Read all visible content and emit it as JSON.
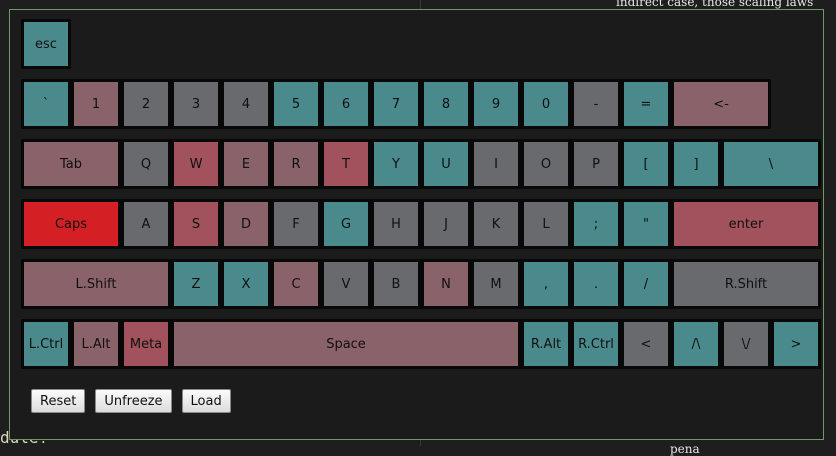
{
  "palette": {
    "teal": "#4a8a8d",
    "mauve": "#8a6269",
    "gray": "#686a6d",
    "rose": "#a2525c",
    "red": "#d41f24"
  },
  "rows": [
    [
      {
        "label": "esc",
        "color": "teal",
        "w": 1
      }
    ],
    [
      {
        "label": "`",
        "color": "teal",
        "w": 1
      },
      {
        "label": "1",
        "color": "mauve",
        "w": 1
      },
      {
        "label": "2",
        "color": "gray",
        "w": 1
      },
      {
        "label": "3",
        "color": "gray",
        "w": 1
      },
      {
        "label": "4",
        "color": "gray",
        "w": 1
      },
      {
        "label": "5",
        "color": "teal",
        "w": 1
      },
      {
        "label": "6",
        "color": "teal",
        "w": 1
      },
      {
        "label": "7",
        "color": "teal",
        "w": 1
      },
      {
        "label": "8",
        "color": "teal",
        "w": 1
      },
      {
        "label": "9",
        "color": "teal",
        "w": 1
      },
      {
        "label": "0",
        "color": "teal",
        "w": 1
      },
      {
        "label": "-",
        "color": "gray",
        "w": 1
      },
      {
        "label": "=",
        "color": "teal",
        "w": 1
      },
      {
        "label": "<-",
        "color": "mauve",
        "w": 2
      }
    ],
    [
      {
        "label": "Tab",
        "color": "mauve",
        "w": 2
      },
      {
        "label": "Q",
        "color": "gray",
        "w": 1
      },
      {
        "label": "W",
        "color": "rose",
        "w": 1
      },
      {
        "label": "E",
        "color": "mauve",
        "w": 1
      },
      {
        "label": "R",
        "color": "mauve",
        "w": 1
      },
      {
        "label": "T",
        "color": "rose",
        "w": 1
      },
      {
        "label": "Y",
        "color": "teal",
        "w": 1
      },
      {
        "label": "U",
        "color": "teal",
        "w": 1
      },
      {
        "label": "I",
        "color": "gray",
        "w": 1
      },
      {
        "label": "O",
        "color": "gray",
        "w": 1
      },
      {
        "label": "P",
        "color": "gray",
        "w": 1
      },
      {
        "label": "[",
        "color": "teal",
        "w": 1
      },
      {
        "label": "]",
        "color": "teal",
        "w": 1
      },
      {
        "label": "\\",
        "color": "teal",
        "w": 2
      }
    ],
    [
      {
        "label": "Caps",
        "color": "red",
        "w": 2
      },
      {
        "label": "A",
        "color": "gray",
        "w": 1
      },
      {
        "label": "S",
        "color": "rose",
        "w": 1
      },
      {
        "label": "D",
        "color": "mauve",
        "w": 1
      },
      {
        "label": "F",
        "color": "gray",
        "w": 1
      },
      {
        "label": "G",
        "color": "teal",
        "w": 1
      },
      {
        "label": "H",
        "color": "gray",
        "w": 1
      },
      {
        "label": "J",
        "color": "gray",
        "w": 1
      },
      {
        "label": "K",
        "color": "gray",
        "w": 1
      },
      {
        "label": "L",
        "color": "gray",
        "w": 1
      },
      {
        "label": ";",
        "color": "teal",
        "w": 1
      },
      {
        "label": "\"",
        "color": "teal",
        "w": 1
      },
      {
        "label": "enter",
        "color": "rose",
        "w": 3
      }
    ],
    [
      {
        "label": "L.Shift",
        "color": "mauve",
        "w": 3
      },
      {
        "label": "Z",
        "color": "teal",
        "w": 1
      },
      {
        "label": "X",
        "color": "teal",
        "w": 1
      },
      {
        "label": "C",
        "color": "mauve",
        "w": 1
      },
      {
        "label": "V",
        "color": "gray",
        "w": 1
      },
      {
        "label": "B",
        "color": "gray",
        "w": 1
      },
      {
        "label": "N",
        "color": "mauve",
        "w": 1
      },
      {
        "label": "M",
        "color": "gray",
        "w": 1
      },
      {
        "label": ",",
        "color": "teal",
        "w": 1
      },
      {
        "label": ".",
        "color": "teal",
        "w": 1
      },
      {
        "label": "/",
        "color": "teal",
        "w": 1
      },
      {
        "label": "R.Shift",
        "color": "gray",
        "w": 3
      }
    ],
    [
      {
        "label": "L.Ctrl",
        "color": "teal",
        "w": 1
      },
      {
        "label": "L.Alt",
        "color": "mauve",
        "w": 1
      },
      {
        "label": "Meta",
        "color": "rose",
        "w": 1
      },
      {
        "label": "Space",
        "color": "mauve",
        "w": 7
      },
      {
        "label": "R.Alt",
        "color": "teal",
        "w": 1
      },
      {
        "label": "R.Ctrl",
        "color": "teal",
        "w": 1
      },
      {
        "label": "<",
        "color": "gray",
        "w": 1
      },
      {
        "label": "/\\",
        "color": "teal",
        "w": 1
      },
      {
        "label": "\\/",
        "color": "gray",
        "w": 1
      },
      {
        "label": ">",
        "color": "teal",
        "w": 1
      }
    ]
  ],
  "buttons": {
    "reset": "Reset",
    "unfreeze": "Unfreeze",
    "load": "Load"
  },
  "background_text": {
    "top_right": "indirect case, those scaling laws and",
    "bottom_right": "to lead to a strict rate pena",
    "bottom_left": "dule!"
  }
}
